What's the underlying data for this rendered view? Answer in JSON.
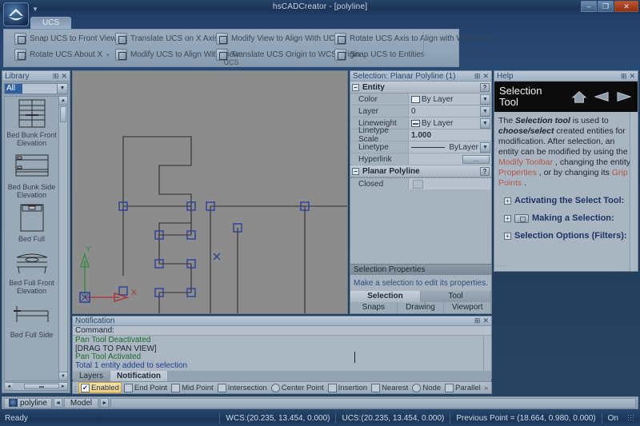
{
  "window": {
    "title": "hsCADCreator - [polyline]",
    "minimize": "–",
    "maximize": "❐",
    "close": "✕",
    "mdi_minimize": "_",
    "mdi_restore": "❐",
    "mdi_close": "✕"
  },
  "ribbon": {
    "tabs": [
      {
        "label": "UCS",
        "active": true
      }
    ],
    "group_label": "UCS",
    "buttons": [
      {
        "label": "Snap UCS to Front View",
        "icon": "ucs-front-view-icon",
        "caret": "▾"
      },
      {
        "label": "Rotate UCS About X",
        "icon": "rotate-ucs-x-icon",
        "caret": "▾"
      },
      {
        "label": "Translate UCS on X Axis",
        "icon": "translate-ucs-x-icon",
        "caret": "▾"
      },
      {
        "label": "Modify UCS to Align With View",
        "icon": "modify-ucs-align-view-icon",
        "caret": ""
      },
      {
        "label": "Modify View to Align With UCS",
        "icon": "modify-view-align-ucs-icon",
        "caret": ""
      },
      {
        "label": "Translate UCS Origin to WCS Origin",
        "icon": "translate-origin-wcs-icon",
        "caret": ""
      },
      {
        "label": "Rotate UCS Axis to Align with WCS Axis",
        "icon": "rotate-ucs-axis-wcs-icon",
        "caret": ""
      },
      {
        "label": "Snap UCS to Entities",
        "icon": "snap-ucs-entities-icon",
        "caret": ""
      }
    ]
  },
  "library": {
    "title": "Library",
    "pin": "⊞",
    "close": "✕",
    "filter_value": "All",
    "dropdown_caret": "▼",
    "items": [
      {
        "label": "Bed Bunk Front Elevation",
        "thumb": "bed-bunk-front-thumb"
      },
      {
        "label": "Bed Bunk Side Elevation",
        "thumb": "bed-bunk-side-thumb"
      },
      {
        "label": "Bed Full",
        "thumb": "bed-full-thumb"
      },
      {
        "label": "Bed Full Front Elevation",
        "thumb": "bed-full-front-thumb"
      },
      {
        "label": "Bed Full Side",
        "thumb": "bed-full-side-thumb"
      }
    ],
    "scroll_up": "▲",
    "scroll_down": "▼",
    "scroll_left": "◄",
    "scroll_right": "►",
    "hthumb": "▬"
  },
  "canvas": {
    "axis_x_label": "X",
    "axis_y_label": "Y",
    "grip_color": "#2b3f9e",
    "entity_color": "#2e2e2e",
    "background": "#8c8c8c",
    "axis_x_color": "#a83232",
    "axis_y_color": "#2e8b3d"
  },
  "selection_panel": {
    "title": "Selection: Planar Polyline (1)",
    "pin": "⊞",
    "close": "✕",
    "sections": [
      {
        "name": "Entity",
        "expander": "−",
        "help_glyph": "?",
        "rows": [
          {
            "key": "Color",
            "value": "By Layer",
            "control": "color-swatch-dropdown"
          },
          {
            "key": "Layer",
            "value": "0",
            "control": "dropdown"
          },
          {
            "key": "Lineweight",
            "value": "By Layer",
            "control": "lineweight-swatch-dropdown"
          },
          {
            "key": "Linetype Scale",
            "value": "1.000",
            "control": "text"
          },
          {
            "key": "Linetype",
            "value": "ByLayer",
            "control": "linetype-dropdown"
          },
          {
            "key": "Hyperlink",
            "value": "",
            "control": "ellipsis-button",
            "button_label": "..."
          }
        ]
      },
      {
        "name": "Planar Polyline",
        "expander": "−",
        "help_glyph": "?",
        "rows": [
          {
            "key": "Closed",
            "value": "",
            "control": "checkbox"
          }
        ]
      }
    ],
    "properties_header": "Selection Properties",
    "properties_message": "Make a selection to edit its properties.",
    "tabs_row1": [
      {
        "label": "Selection",
        "active": true
      },
      {
        "label": "Tool",
        "active": false
      }
    ],
    "tabs_row2": [
      {
        "label": "Snaps"
      },
      {
        "label": "Drawing"
      },
      {
        "label": "Viewport"
      }
    ]
  },
  "help_panel": {
    "title": "Help",
    "pin": "⊞",
    "close": "✕",
    "hero_title": "Selection Tool",
    "nav": [
      {
        "name": "home-icon"
      },
      {
        "name": "back-arrow-icon"
      },
      {
        "name": "forward-arrow-icon"
      }
    ],
    "body": {
      "p1_a": "The ",
      "p1_b": "Selection tool",
      "p1_c": " is used to ",
      "p1_d": "choose/select",
      "p1_e": " created entities for modification. After selection, an entity can be modified by using the ",
      "link1": "Modify Toolbar",
      "p1_f": " , changing the entity ",
      "link2": "Properties",
      "p1_g": " , or by changing its ",
      "link3": "Grip Points",
      "p1_h": " ."
    },
    "toc": [
      {
        "label": "Activating the Select Tool:",
        "expander": "+",
        "glyph": false
      },
      {
        "label": "Making a Selection:",
        "expander": "+",
        "glyph": true
      },
      {
        "label": "Selection Options (Filters):",
        "expander": "+",
        "glyph": false
      }
    ],
    "dots": "..."
  },
  "notification_panel": {
    "title": "Notification",
    "pin": "⊞",
    "close": "✕",
    "command_label": "Command:",
    "log": [
      {
        "text": "Pan Tool Deactivated",
        "color": "#1f6b2e"
      },
      {
        "text": "[DRAG TO PAN VIEW]",
        "color": "#1b2630"
      },
      {
        "text": "Pan Tool Activated",
        "color": "#1f6b2e"
      },
      {
        "text": "Total 1 entity added to selection",
        "color": "#1d3f8f"
      }
    ],
    "tabs": [
      {
        "label": "Layers",
        "active": false
      },
      {
        "label": "Notification",
        "active": true
      }
    ]
  },
  "snap_toolbar": {
    "items": [
      {
        "label": "Enabled",
        "icon": "checkbox-checked-icon",
        "enabled": true,
        "check": "✔"
      },
      {
        "label": "End Point",
        "icon": "end-point-icon",
        "enabled": false
      },
      {
        "label": "Mid Point",
        "icon": "mid-point-icon",
        "enabled": false
      },
      {
        "label": "Intersection",
        "icon": "intersection-icon",
        "enabled": false
      },
      {
        "label": "Center Point",
        "icon": "center-point-icon",
        "enabled": false
      },
      {
        "label": "Insertion",
        "icon": "insertion-icon",
        "enabled": false
      },
      {
        "label": "Nearest",
        "icon": "nearest-icon",
        "enabled": false
      },
      {
        "label": "Node",
        "icon": "node-icon",
        "enabled": false
      },
      {
        "label": "Parallel",
        "icon": "parallel-icon",
        "enabled": false
      }
    ],
    "overflow": "»"
  },
  "doc_tabs": {
    "document": "polyline",
    "doc_icon": "document-icon",
    "prev": "◄",
    "next": "►",
    "model_tab": "Model"
  },
  "status_bar": {
    "ready": "Ready",
    "wcs": "WCS:(20.235, 13.454, 0.000)",
    "ucs": "UCS:(20.235, 13.454, 0.000)",
    "previous_point": "Previous Point = (18.664, 0.980, 0.000)",
    "toggle": "On"
  }
}
